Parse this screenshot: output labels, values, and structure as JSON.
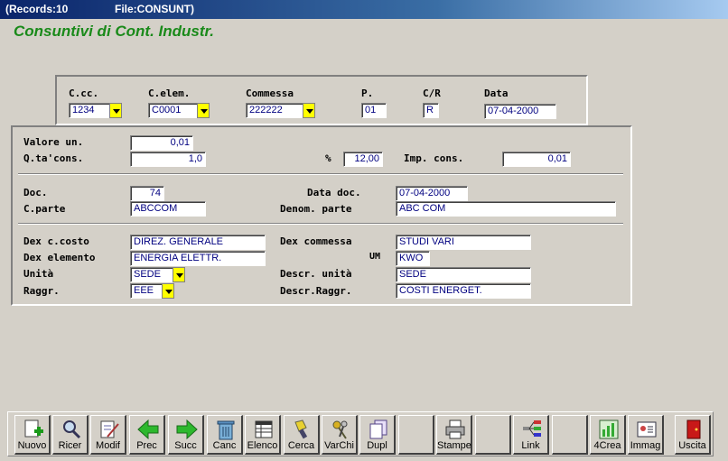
{
  "titlebar": {
    "records": "(Records:10",
    "file": "File:CONSUNT)"
  },
  "app_title": "Consuntivi di Cont. Industr.",
  "header": {
    "ccc": {
      "label": "C.cc.",
      "value": "1234"
    },
    "celem": {
      "label": "C.elem.",
      "value": "C0001"
    },
    "commessa": {
      "label": "Commessa",
      "value": "222222"
    },
    "p": {
      "label": "P.",
      "value": "01"
    },
    "cr": {
      "label": "C/R",
      "value": "R"
    },
    "data": {
      "label": "Data",
      "value": "07-04-2000"
    }
  },
  "values": {
    "valore_un": {
      "label": "Valore un.",
      "value": "0,01"
    },
    "qta_cons": {
      "label": "Q.ta'cons.",
      "value": "1,0"
    },
    "perc": {
      "label": "%",
      "value": "12,00"
    },
    "imp_cons": {
      "label": "Imp. cons.",
      "value": "0,01"
    }
  },
  "doc": {
    "doc": {
      "label": "Doc.",
      "value": "74"
    },
    "data_doc": {
      "label": "Data doc.",
      "value": "07-04-2000"
    },
    "cparte": {
      "label": "C.parte",
      "value": "ABCCOM"
    },
    "denom_parte": {
      "label": "Denom. parte",
      "value": "ABC COM"
    }
  },
  "desc": {
    "dex_ccosto": {
      "label": "Dex c.costo",
      "value": "DIREZ. GENERALE"
    },
    "dex_commessa": {
      "label": "Dex commessa",
      "value": "STUDI VARI"
    },
    "dex_elemento": {
      "label": "Dex elemento",
      "value": "ENERGIA ELETTR."
    },
    "um": {
      "label": "UM",
      "value": "KWO"
    },
    "unita": {
      "label": "Unità",
      "value": "SEDE"
    },
    "descr_unita": {
      "label": "Descr. unità",
      "value": "SEDE"
    },
    "raggr": {
      "label": "Raggr.",
      "value": "EEE"
    },
    "descr_raggr": {
      "label": "Descr.Raggr.",
      "value": "COSTI ENERGET."
    }
  },
  "toolbar": {
    "nuovo": "Nuovo",
    "ricer": "Ricer",
    "modif": "Modif",
    "prec": "Prec",
    "succ": "Succ",
    "canc": "Canc",
    "elenco": "Elenco",
    "cerca": "Cerca",
    "varchi": "VarChi",
    "dupl": "Dupl",
    "stampe": "Stampe",
    "link": "Link",
    "crea": "4Crea",
    "immag": "Immag",
    "uscita": "Uscita"
  },
  "colors": {
    "title_green": "#1a8a1a",
    "field_text": "#000080",
    "dropdown": "#ffff00"
  }
}
